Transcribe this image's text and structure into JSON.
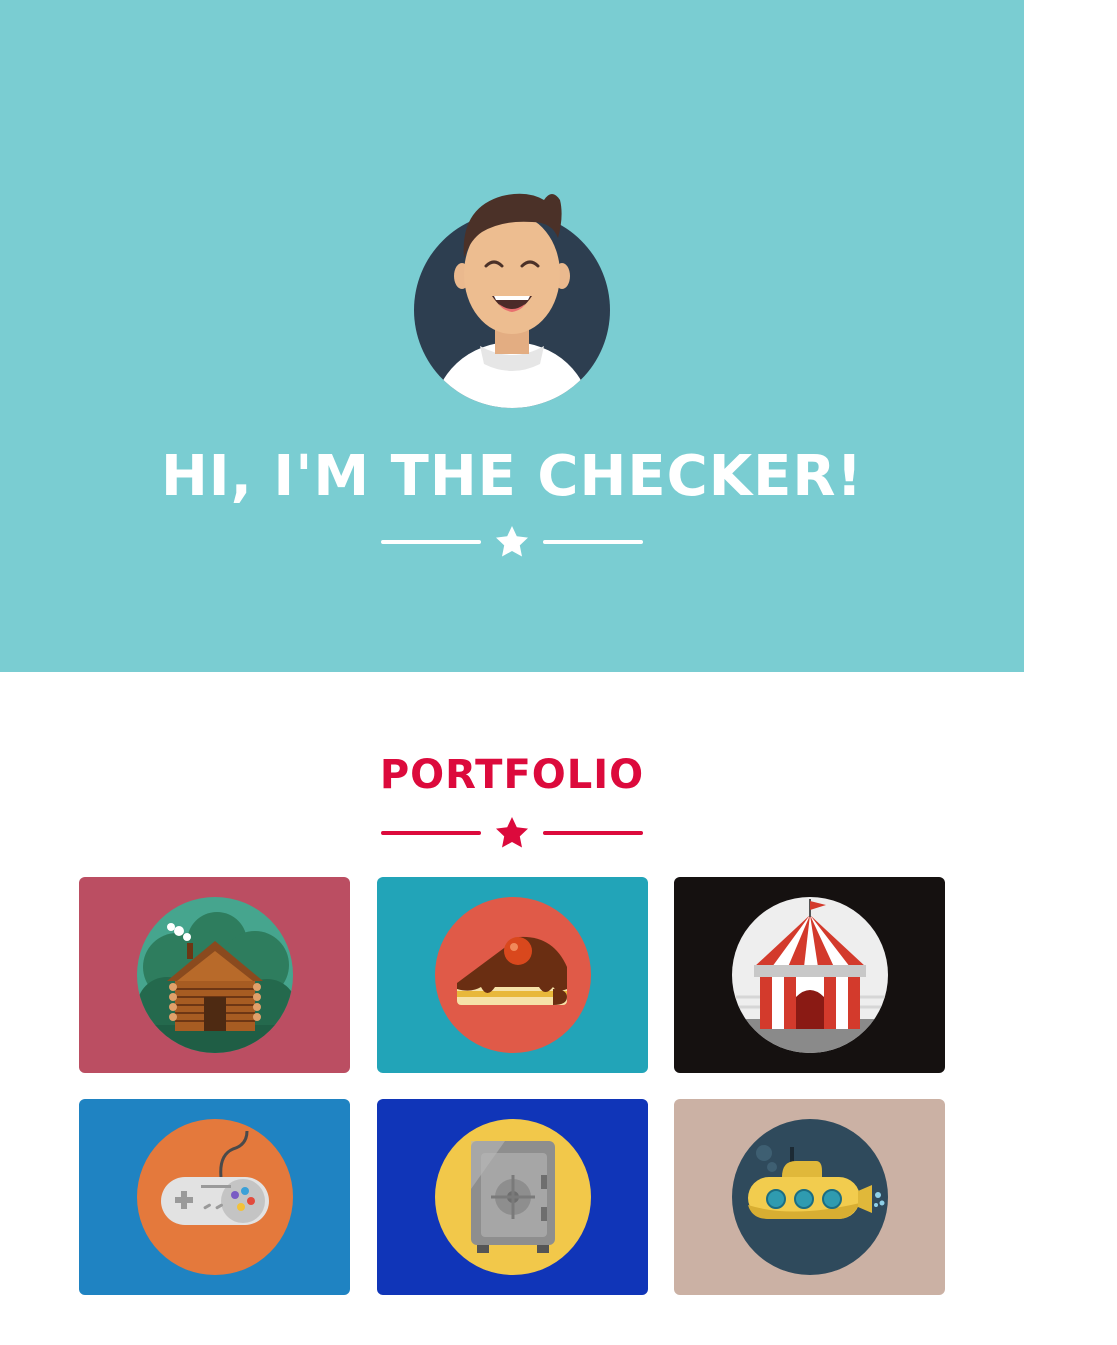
{
  "hero": {
    "title": "HI, I'M THE CHECKER!",
    "background": "#7acdd2",
    "avatar_icon": "avatar-illustration",
    "divider_icon": "star-icon"
  },
  "portfolio": {
    "title": "PORTFOLIO",
    "title_color": "#dc0a3c",
    "divider_icon": "star-icon",
    "items": [
      {
        "name": "log-cabin",
        "icon": "cabin-icon",
        "background": "#bb4e62"
      },
      {
        "name": "cake",
        "icon": "cake-icon",
        "background": "#22a4b8"
      },
      {
        "name": "circus",
        "icon": "circus-tent-icon",
        "background": "#151110"
      },
      {
        "name": "game",
        "icon": "gamepad-icon",
        "background": "#1f83c2"
      },
      {
        "name": "safe",
        "icon": "safe-icon",
        "background": "#1035b8"
      },
      {
        "name": "submarine",
        "icon": "submarine-icon",
        "background": "#cbb1a4"
      }
    ]
  }
}
